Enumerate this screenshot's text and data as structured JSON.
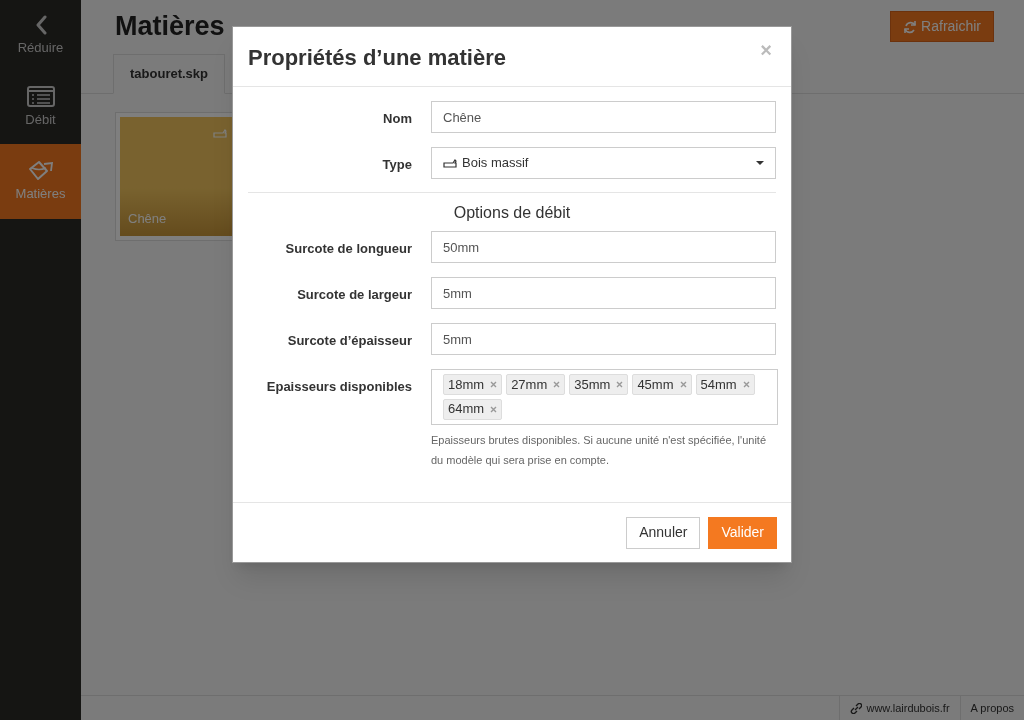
{
  "sidebar": {
    "items": [
      {
        "label": "Réduire",
        "kind": "collapse",
        "selected": false
      },
      {
        "label": "Débit",
        "kind": "list",
        "selected": false
      },
      {
        "label": "Matières",
        "kind": "materials",
        "selected": true
      }
    ]
  },
  "page": {
    "title": "Matières",
    "refresh_button": "Rafraichir"
  },
  "tabs": [
    {
      "label": "tabouret.skp",
      "selected": true
    }
  ],
  "materials": [
    {
      "name": "Chêne"
    }
  ],
  "footer": {
    "links": [
      {
        "label": "www.lairdubois.fr",
        "kind": "link"
      },
      {
        "label": "A propos",
        "kind": "plain"
      }
    ]
  },
  "dialog": {
    "title": "Propriétés d’une matière",
    "close": "×",
    "fields": [
      {
        "label": "Nom",
        "kind": "text",
        "value": "Chêne"
      },
      {
        "label": "Type",
        "kind": "select",
        "value": "Bois massif"
      }
    ],
    "section_title": "Options de débit",
    "cutting_fields": [
      {
        "label": "Surcote de longueur",
        "kind": "text",
        "value": "50mm"
      },
      {
        "label": "Surcote de largeur",
        "kind": "text",
        "value": "5mm"
      },
      {
        "label": "Surcote d’épaisseur",
        "kind": "text",
        "value": "5mm"
      }
    ],
    "thicknesses": {
      "label": "Epaisseurs disponibles",
      "tags": [
        "18mm",
        "27mm",
        "35mm",
        "45mm",
        "54mm",
        "64mm"
      ],
      "help": "Epaisseurs brutes disponibles. Si aucune unité n'est spécifiée, l'unité du modèle qui sera prise en compte."
    },
    "buttons": [
      {
        "label": "Annuler",
        "kind": "secondary"
      },
      {
        "label": "Valider",
        "kind": "primary"
      }
    ]
  }
}
